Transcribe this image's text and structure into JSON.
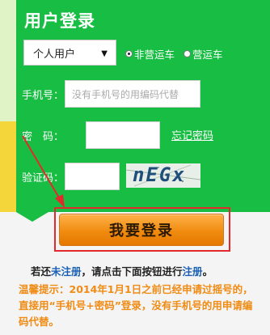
{
  "title": "用户登录",
  "user_type": {
    "selected": "个人用户",
    "options": [
      "个人用户"
    ]
  },
  "vehicle_type": {
    "options": [
      {
        "label": "非营运车",
        "checked": true
      },
      {
        "label": "营运车",
        "checked": false
      }
    ]
  },
  "fields": {
    "phone_label": "手机号：",
    "phone_placeholder": "没有手机号的用编码代替",
    "password_label": "密　码：",
    "forgot_link": "忘记密码",
    "captcha_label": "验证码：",
    "captcha_text": "nEGx"
  },
  "login_button": "我要登录",
  "register": {
    "prefix": "若还",
    "link1": "未注册",
    "middle": "，请点击下面按钮进行",
    "link2": "注册",
    "suffix": "。"
  },
  "notice": "温馨提示：2014年1月1日之前已经申请过摇号的，直接用“手机号+密码”登录，没有手机号的用申请编码代替。",
  "colors": {
    "panel_green": "#18be43",
    "button_orange": "#f08c10",
    "highlight_red": "#e2292b",
    "link_blue": "#1a5fb4",
    "notice_orange": "#f08b14"
  }
}
